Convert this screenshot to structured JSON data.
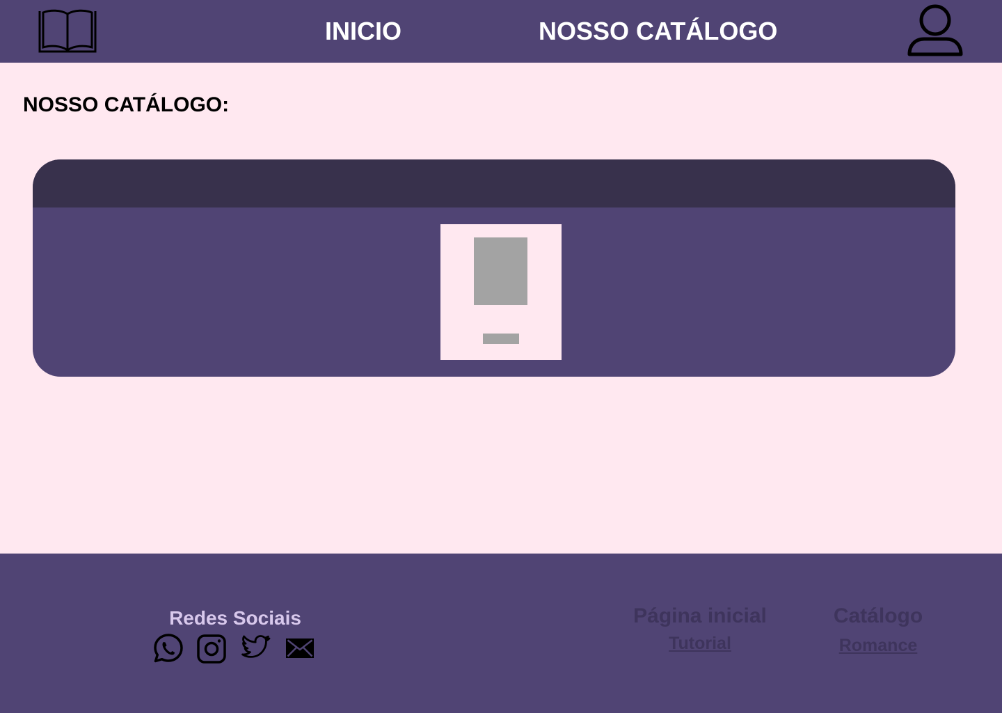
{
  "header": {
    "logo_icon": "open-book-icon",
    "nav": {
      "home_label": "INICIO",
      "catalog_label": "NOSSO CATÁLOGO"
    },
    "user_icon": "user-icon"
  },
  "main": {
    "title": "NOSSO CATÁLOGO:",
    "carousel": {
      "items": [
        {
          "cover": "image-placeholder",
          "title_placeholder": "text-placeholder"
        }
      ]
    }
  },
  "footer": {
    "social": {
      "title": "Redes Sociais",
      "icons": [
        "whatsapp-icon",
        "instagram-icon",
        "twitter-icon",
        "mail-icon"
      ]
    },
    "links": {
      "home_heading": "Página inicial",
      "tutorial_link": "Tutorial",
      "catalog_heading": "Catálogo",
      "romance_link": "Romance"
    }
  },
  "colors": {
    "primary": "#504474",
    "dark": "#38314C",
    "background": "#FFE8F0",
    "placeholder": "#A3A3A3",
    "social_title": "#D8C8EC",
    "footer_text": "#3E345C"
  }
}
